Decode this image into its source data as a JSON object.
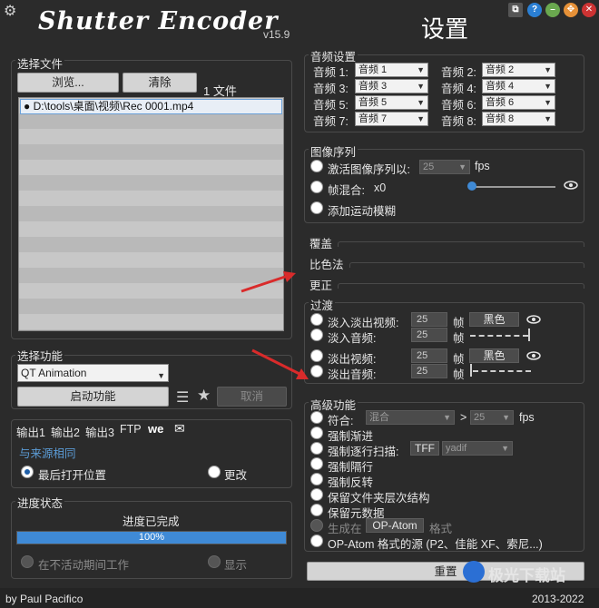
{
  "header": {
    "logo": "Shutter Encoder",
    "version": "v15.9",
    "page_title": "设置",
    "window_buttons": [
      "restore-icon",
      "help-icon",
      "minimize-icon",
      "maximize-icon",
      "close-icon"
    ]
  },
  "file_panel": {
    "title": "选择文件",
    "browse": "浏览...",
    "clear": "清除",
    "count": "1 文件",
    "files": [
      "D:\\tools\\桌面\\视频\\Rec 0001.mp4"
    ]
  },
  "function_panel": {
    "title": "选择功能",
    "selected": "QT Animation",
    "start": "启动功能",
    "cancel": "取消"
  },
  "output_panel": {
    "tabs": [
      "输出1",
      "输出2",
      "输出3",
      "FTP"
    ],
    "same_as_source": "与来源相同",
    "last_open": "最后打开位置",
    "change": "更改"
  },
  "progress_panel": {
    "title": "进度状态",
    "status": "进度已完成",
    "percent": "100%",
    "progress": 1.0,
    "idle_work": "在不活动期间工作",
    "show": "显示"
  },
  "footer": {
    "author": "by Paul Pacifico",
    "years": "2013-2022"
  },
  "audio": {
    "title": "音频设置",
    "tracks": [
      {
        "label": "音频 1:",
        "value": "音频 1"
      },
      {
        "label": "音频 2:",
        "value": "音频 2"
      },
      {
        "label": "音频 3:",
        "value": "音频 3"
      },
      {
        "label": "音频 4:",
        "value": "音频 4"
      },
      {
        "label": "音频 5:",
        "value": "音频 5"
      },
      {
        "label": "音频 6:",
        "value": "音频 6"
      },
      {
        "label": "音频 7:",
        "value": "音频 7"
      },
      {
        "label": "音频 8:",
        "value": "音频 8"
      }
    ]
  },
  "image_seq": {
    "title": "图像序列",
    "activate": "激活图像序列以:",
    "fps_value": "25",
    "fps": "fps",
    "blend": "帧混合:",
    "blend_value": "x0",
    "motion_blur": "添加运动模糊"
  },
  "sections": {
    "overlay": "覆盖",
    "colorimetry": "比色法",
    "correction": "更正"
  },
  "transition": {
    "title": "过渡",
    "fade_in_video": "淡入淡出视频:",
    "fade_in_audio": "淡入音频:",
    "fade_out_video": "淡出视频:",
    "fade_out_audio": "淡出音频:",
    "frames": "25",
    "frame_unit": "帧",
    "color": "黑色"
  },
  "advanced": {
    "title": "高级功能",
    "conform": "符合:",
    "conform_mode": "混合",
    "gt": ">",
    "conform_fps": "25",
    "fps": "fps",
    "force_progressive": "强制渐进",
    "force_interlace": "强制逐行扫描:",
    "field_order": "TFF",
    "deint": "yadif",
    "force_interlaced_line": "强制隔行",
    "force_reverse": "强制反转",
    "keep_structure": "保留文件夹层次结构",
    "keep_metadata": "保留元数据",
    "generate_in": "生成在",
    "op_atom": "OP-Atom",
    "format": "格式",
    "op_atom_source": "OP-Atom 格式的源 (P2、佳能 XF、索尼...)"
  },
  "reset": "重置",
  "watermark": "极光下载站"
}
